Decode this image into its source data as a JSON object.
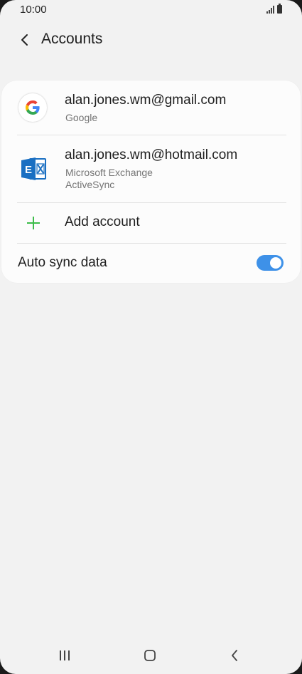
{
  "status_bar": {
    "time": "10:00"
  },
  "header": {
    "title": "Accounts"
  },
  "accounts": [
    {
      "email": "alan.jones.wm@gmail.com",
      "type_lines": [
        "Google"
      ],
      "icon": "google-icon"
    },
    {
      "email": "alan.jones.wm@hotmail.com",
      "type_lines": [
        "Microsoft Exchange",
        "ActiveSync"
      ],
      "icon": "exchange-icon"
    }
  ],
  "add_account": {
    "label": "Add account",
    "icon": "plus-icon"
  },
  "auto_sync": {
    "label": "Auto sync data",
    "enabled": true
  },
  "colors": {
    "background": "#f2f2f2",
    "card": "#fcfcfc",
    "accent": "#3e91e8",
    "plus": "#3dbd4a"
  },
  "nav_bar": {
    "icons": [
      "recent-apps-icon",
      "home-icon",
      "back-icon"
    ]
  }
}
